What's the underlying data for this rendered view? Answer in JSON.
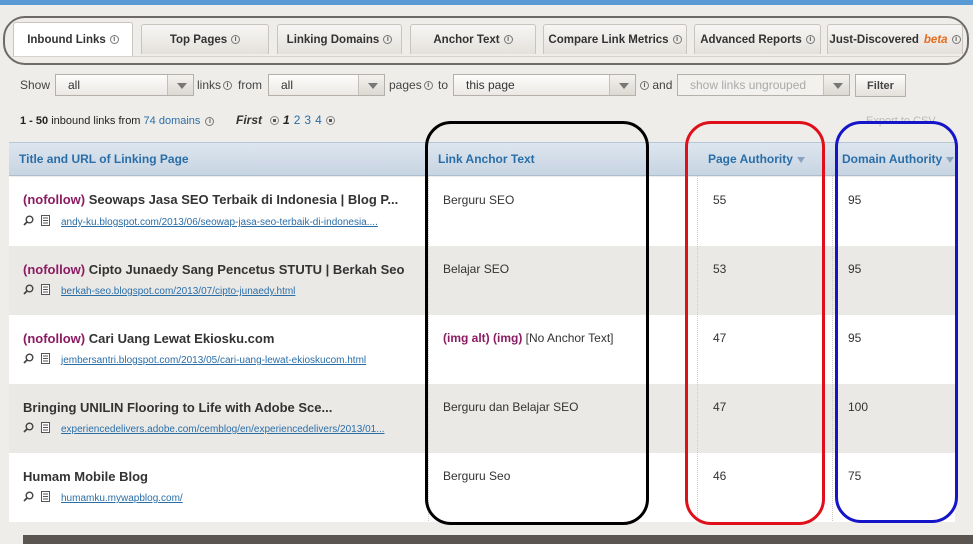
{
  "tabs": [
    {
      "label": "Inbound Links",
      "active": true
    },
    {
      "label": "Top Pages"
    },
    {
      "label": "Linking Domains"
    },
    {
      "label": "Anchor Text"
    },
    {
      "label": "Compare Link Metrics"
    },
    {
      "label": "Advanced Reports"
    },
    {
      "label": "Just-Discovered",
      "badge": "beta"
    }
  ],
  "filters": {
    "show_label": "Show",
    "show_value": "all",
    "links_label": "links",
    "from_label": "from",
    "from_value": "all",
    "pages_label": "pages",
    "to_label": "to",
    "to_value": "this page",
    "and_label": "and",
    "group_value": "show links ungrouped",
    "filter_button": "Filter"
  },
  "summary": {
    "range": "1 - 50",
    "text": "inbound links from",
    "domains_link": "74 domains"
  },
  "pagination": {
    "first": "First",
    "current": "1",
    "pages": [
      "2",
      "3",
      "4"
    ]
  },
  "export_label": "Export to CSV",
  "table": {
    "headers": {
      "title_url": "Title and URL of Linking Page",
      "anchor": "Link Anchor Text",
      "page_authority": "Page Authority",
      "domain_authority": "Domain Authority"
    },
    "rows": [
      {
        "nofollow": "(nofollow)",
        "title": "Seowaps Jasa SEO Terbaik di Indonesia | Blog P...",
        "url": "andy-ku.blogspot.com/2013/06/seowap-jasa-seo-terbaik-di-indonesia....",
        "anchor_prefix": "",
        "anchor": "Berguru SEO",
        "pa": "55",
        "da": "95"
      },
      {
        "nofollow": "(nofollow)",
        "title": "Cipto Junaedy Sang Pencetus STUTU | Berkah Seo",
        "url": "berkah-seo.blogspot.com/2013/07/cipto-junaedy.html",
        "anchor_prefix": "",
        "anchor": "Belajar SEO",
        "pa": "53",
        "da": "95"
      },
      {
        "nofollow": "(nofollow)",
        "title": "Cari Uang Lewat Ekiosku.com",
        "url": "jembersantri.blogspot.com/2013/05/cari-uang-lewat-ekioskucom.html",
        "anchor_prefix": "(img alt) (img)",
        "anchor": "[No Anchor Text]",
        "pa": "47",
        "da": "95"
      },
      {
        "nofollow": "",
        "title": "Bringing UNILIN Flooring to Life with Adobe Sce...",
        "url": "experiencedelivers.adobe.com/cemblog/en/experiencedelivers/2013/01...",
        "anchor_prefix": "",
        "anchor": "Berguru dan Belajar SEO",
        "pa": "47",
        "da": "100"
      },
      {
        "nofollow": "",
        "title": "Humam Mobile Blog",
        "url": "humamku.mywapblog.com/",
        "anchor_prefix": "",
        "anchor": "Berguru Seo",
        "pa": "46",
        "da": "75"
      }
    ]
  },
  "annotation_colors": {
    "anchor_column": "#000000",
    "page_authority_column": "#e0101a",
    "domain_authority_column": "#1414c8",
    "tab_group": "#6e6a67"
  }
}
